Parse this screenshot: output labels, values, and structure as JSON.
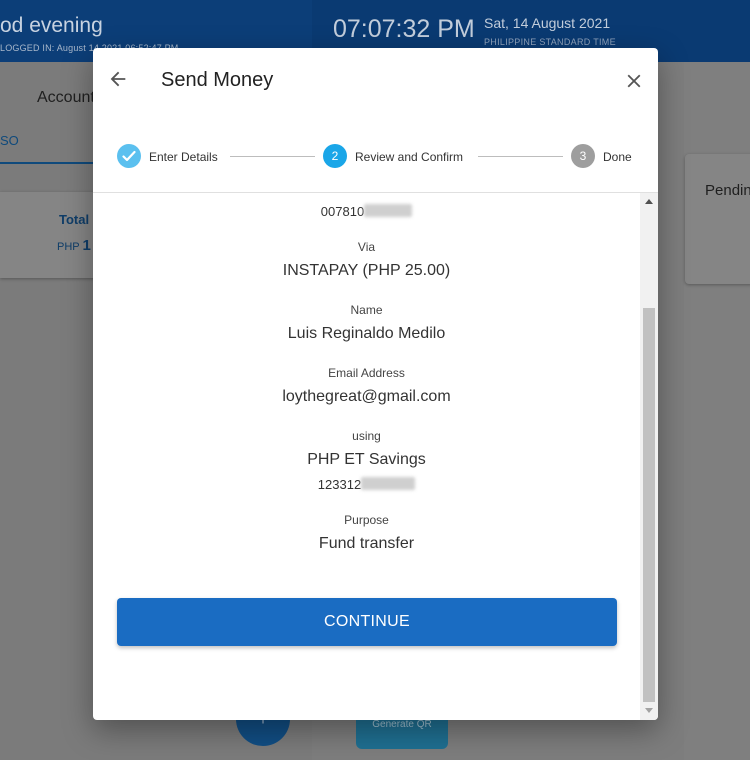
{
  "background": {
    "greeting": "od evening",
    "logged_in": "LOGGED IN: August 14 2021 06:52:47 PM",
    "clock": "07:07:32 PM",
    "date": "Sat, 14 August 2021",
    "timezone": "PHILIPPINE STANDARD TIME",
    "accounts_tab": "Account",
    "so_tab": "SO",
    "total_label": "Total",
    "total_currency": "PHP",
    "total_amount": "1",
    "fab_icon": "+",
    "generate_qr": "Generate QR",
    "pending_label": "Pendin"
  },
  "modal": {
    "title": "Send Money",
    "steps": [
      {
        "number": "✓",
        "label": "Enter Details",
        "state": "complete"
      },
      {
        "number": "2",
        "label": "Review and Confirm",
        "state": "active"
      },
      {
        "number": "3",
        "label": "Done",
        "state": "pending"
      }
    ],
    "details": {
      "account_number_visible": "007810",
      "via_label": "Via",
      "via_value": "INSTAPAY (PHP 25.00)",
      "name_label": "Name",
      "name_value": "Luis Reginaldo Medilo",
      "email_label": "Email Address",
      "email_value": "loythegreat@gmail.com",
      "using_label": "using",
      "using_value": "PHP ET Savings",
      "source_account_visible": "123312",
      "purpose_label": "Purpose",
      "purpose_value": "Fund transfer"
    },
    "continue_label": "CONTINUE"
  },
  "colors": {
    "primary_button": "#1a6cc2",
    "step_active": "#1aa6e8",
    "step_complete": "#5bc0ef",
    "step_pending": "#9e9e9e"
  }
}
